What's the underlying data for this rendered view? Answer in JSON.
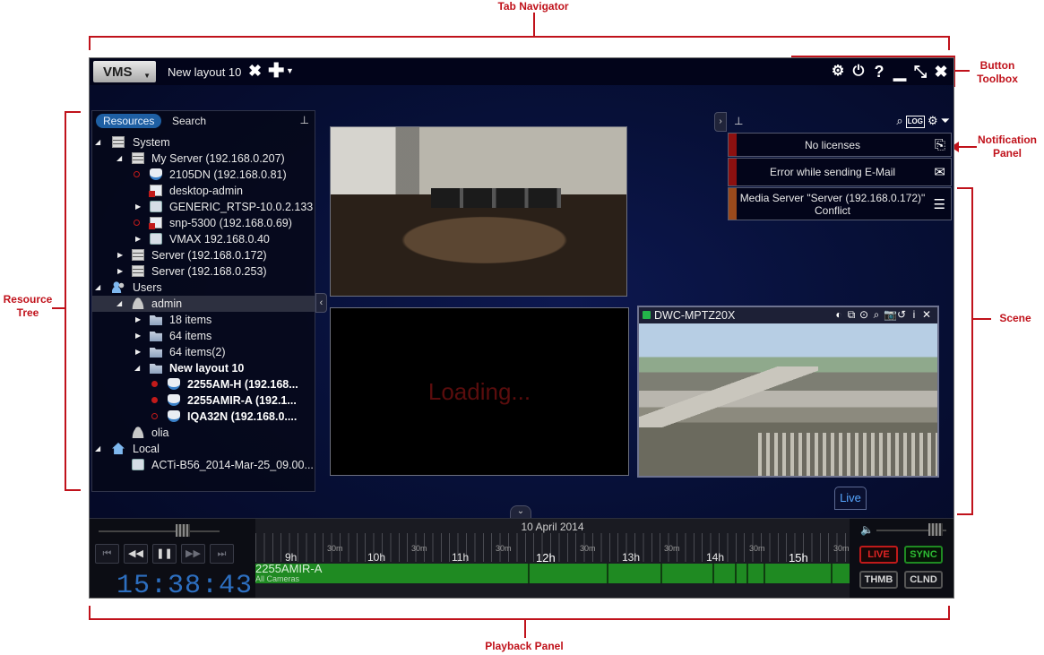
{
  "annotations": {
    "tab_navigator": "Tab Navigator",
    "button_toolbox": "Button\nToolbox",
    "notification_panel": "Notification\nPanel",
    "resource_tree": "Resource\nTree",
    "scene": "Scene",
    "playback_panel": "Playback Panel"
  },
  "titlebar": {
    "logo": "VMS",
    "logo_caret": "▼",
    "layout_tab": "New layout 10",
    "close_tab": "✖",
    "add_tab": "✚",
    "add_caret": "▼",
    "toolbox_icons": [
      "settings-reel-icon",
      "plug-icon",
      "help-icon",
      "minimize-icon",
      "fullscreen-icon",
      "close-icon"
    ],
    "toolbox_glyphs": [
      "⚙",
      "⏻",
      "?",
      "▁",
      "⤡",
      "✖"
    ]
  },
  "resource_tree": {
    "tabs": {
      "resources": "Resources",
      "search": "Search"
    },
    "pin": "📌",
    "items": {
      "system": "System",
      "my_server": "My Server (192.168.0.207)",
      "cam_2105dn": "2105DN (192.168.0.81)",
      "desktop_admin": "desktop-admin",
      "generic_rtsp": "GENERIC_RTSP-10.0.2.133",
      "snp_5300": "snp-5300 (192.168.0.69)",
      "vmax": "VMAX 192.168.0.40",
      "server_172": "Server (192.168.0.172)",
      "server_253": "Server (192.168.0.253)",
      "users": "Users",
      "admin": "admin",
      "items_18": "18 items",
      "items_64": "64 items",
      "items_64_2": "64 items(2)",
      "new_layout_10": "New layout 10",
      "cam_2255am_h": "2255AM-H (192.168...",
      "cam_2255amir_a": "2255AMIR-A (192.1...",
      "cam_iqa32n": "IQA32N (192.168.0....",
      "olia": "olia",
      "local": "Local",
      "acti_file": "ACTi-B56_2014-Mar-25_09.00..."
    }
  },
  "scene": {
    "loading": "Loading...",
    "ptz_camera": {
      "title": "DWC-MPTZ20X",
      "tools": [
        "◐",
        "⧉",
        "⊙",
        "⌕",
        "📷",
        "↺",
        "i",
        "✕"
      ]
    }
  },
  "notifications": {
    "toggle": "›",
    "pin": "📌",
    "tools": {
      "search": "⌕",
      "log": "LOG",
      "settings": "⚙",
      "filter": "⏷"
    },
    "items": [
      {
        "text": "No licenses",
        "color": "#8c1010",
        "icon": "license-icon",
        "glyph": "⎘"
      },
      {
        "text": "Error while sending E-Mail",
        "color": "#8c1010",
        "icon": "mail-error-icon",
        "glyph": "✉"
      },
      {
        "text": "Media Server \"Server (192.168.0.172)\" Conflict",
        "color": "#9a4a1c",
        "icon": "server-icon",
        "glyph": "☰"
      }
    ]
  },
  "playback": {
    "collapse_handle": "⌄",
    "live_tag": "Live",
    "buttons": [
      "⏮",
      "◀◀",
      "❚❚",
      "▶▶",
      "⏭"
    ],
    "clock": "15:38:43",
    "date": "10 April 2014",
    "hours": [
      "9h",
      "10h",
      "11h",
      "12h",
      "13h",
      "14h",
      "15h"
    ],
    "half_hours": [
      "30m",
      "30m",
      "30m",
      "30m",
      "30m",
      "30m",
      "30m",
      "30m"
    ],
    "camera": "2255AMIR-A",
    "camera_group": "All Cameras",
    "volume_icon": "🔈",
    "live_btn": "LIVE",
    "sync_btn": "SYNC",
    "thumbs_btn": "THMB",
    "calendar_btn": "CLND"
  },
  "colors": {
    "accent_blue": "#1e5fa3",
    "clock_blue": "#2d6fc0",
    "recording_red": "#c21a1a",
    "timeline_green": "#1f8a22",
    "annotation_red": "#c0121b"
  }
}
